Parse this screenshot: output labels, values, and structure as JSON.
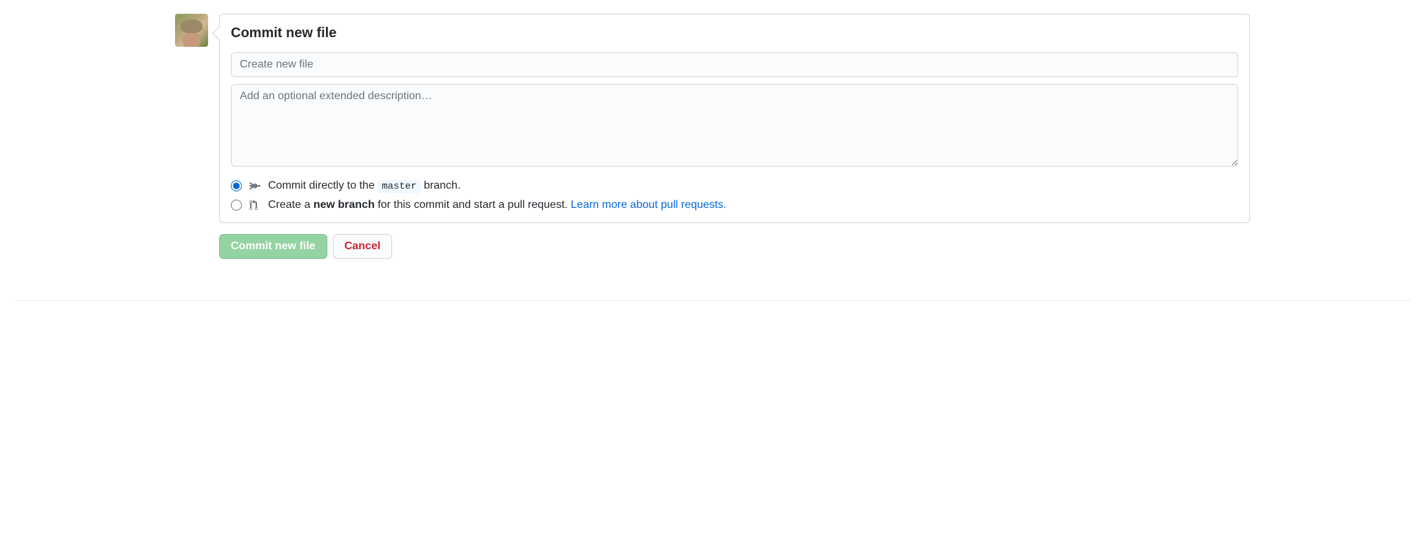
{
  "heading": "Commit new file",
  "summary": {
    "placeholder": "Create new file",
    "value": ""
  },
  "description": {
    "placeholder": "Add an optional extended description…",
    "value": ""
  },
  "options": {
    "direct": {
      "prefix": "Commit directly to the ",
      "branch": "master",
      "suffix": " branch."
    },
    "newbranch": {
      "prefix": "Create a ",
      "bold": "new branch",
      "mid": " for this commit and start a pull request. ",
      "link": "Learn more about pull requests."
    }
  },
  "actions": {
    "commit": "Commit new file",
    "cancel": "Cancel"
  }
}
